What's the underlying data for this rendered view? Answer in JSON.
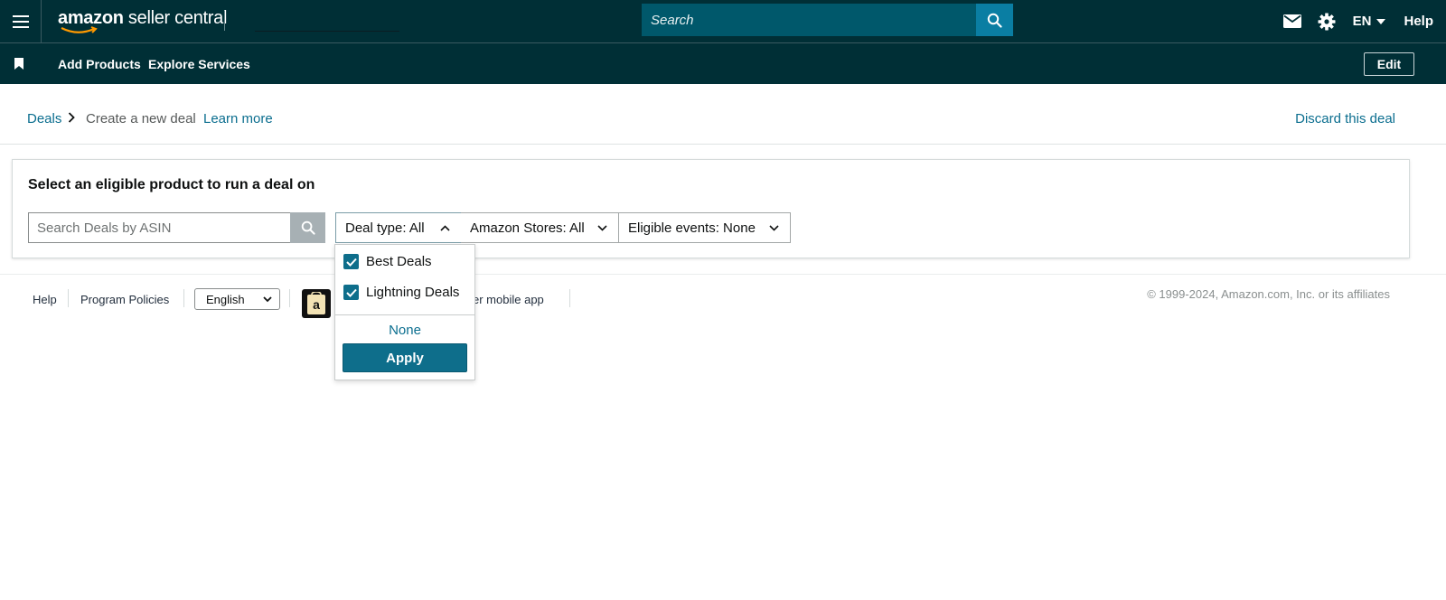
{
  "header": {
    "logo_brand": "amazon",
    "logo_product": " seller central",
    "search_placeholder": "Search",
    "language": "EN",
    "help": "Help"
  },
  "nav": {
    "items": [
      {
        "label": "Add Products"
      },
      {
        "label": "Explore Services"
      }
    ],
    "edit_label": "Edit"
  },
  "breadcrumb": {
    "root": "Deals",
    "current": "Create a new deal",
    "learn_more": "Learn more",
    "discard": "Discard this deal"
  },
  "panel": {
    "title": "Select an eligible product to run a deal on",
    "asin_placeholder": "Search Deals by ASIN",
    "filters": {
      "deal_type": "Deal type: All",
      "stores": "Amazon Stores: All",
      "events": "Eligible events: None"
    }
  },
  "dropdown": {
    "options": [
      {
        "label": "Best Deals",
        "checked": true
      },
      {
        "label": "Lightning Deals",
        "checked": true
      }
    ],
    "none_label": "None",
    "apply_label": "Apply"
  },
  "footer": {
    "help": "Help",
    "policies": "Program Policies",
    "language_selected": "English",
    "app_text": "eller mobile app",
    "copyright": "© 1999-2024, Amazon.com, Inc. or its affiliates"
  },
  "colors": {
    "header_bg": "#002f36",
    "search_bg": "#00586b",
    "search_btn": "#0a7ea3",
    "link": "#0b6e8f",
    "primary_button": "#0e6e8b"
  },
  "icons": {
    "menu": "hamburger-menu-icon",
    "search": "search-icon",
    "mail": "mail-icon",
    "settings": "gear-icon",
    "bookmark": "bookmark-icon"
  }
}
